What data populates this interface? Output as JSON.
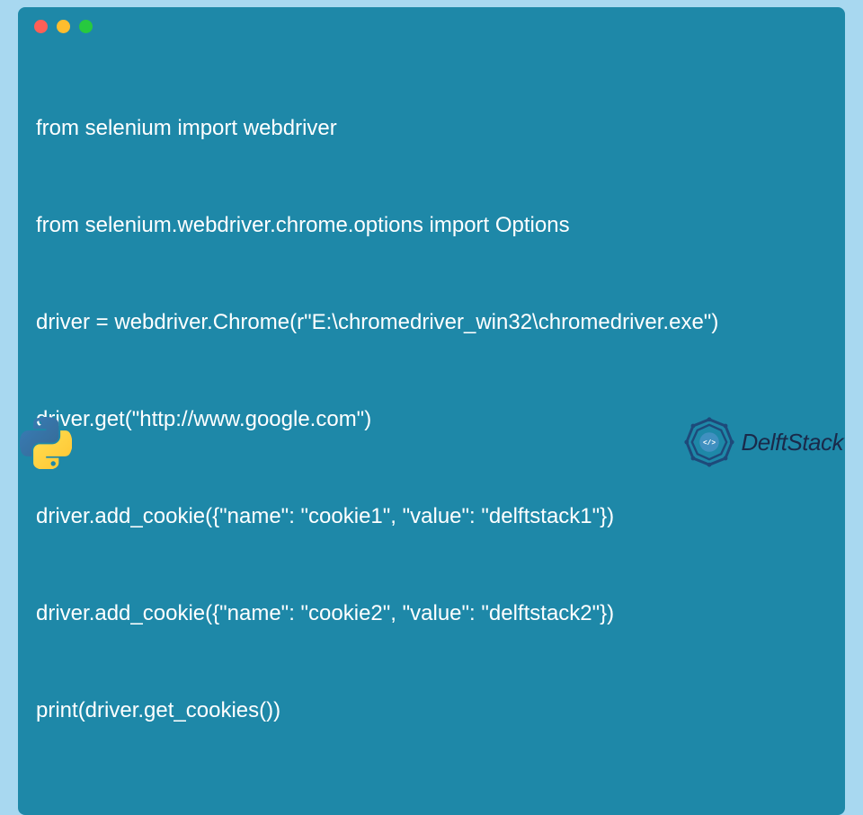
{
  "code": {
    "lines": [
      "from selenium import webdriver",
      "from selenium.webdriver.chrome.options import Options",
      "driver = webdriver.Chrome(r\"E:\\chromedriver_win32\\chromedriver.exe\")",
      "driver.get(\"http://www.google.com\")",
      "driver.add_cookie({\"name\": \"cookie1\", \"value\": \"delftstack1\"})",
      "driver.add_cookie({\"name\": \"cookie2\", \"value\": \"delftstack2\"})",
      "print(driver.get_cookies())"
    ]
  },
  "brand": {
    "name": "DelftStack"
  }
}
